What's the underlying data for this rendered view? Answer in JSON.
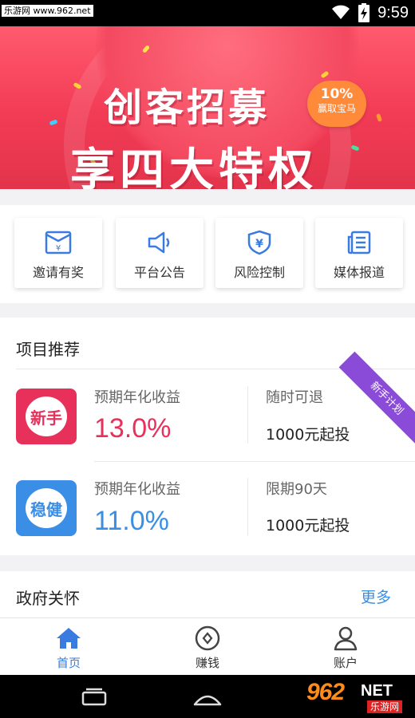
{
  "status_bar": {
    "watermark": "乐游网 www.962.net",
    "time": "9:59"
  },
  "banner": {
    "headline_1": "创客招募",
    "headline_2": "享四大特权",
    "badge_percent": "10%",
    "badge_text": "赢取宝马",
    "page_count": 3,
    "active_page": 2
  },
  "quick_entries": [
    {
      "label": "邀请有奖",
      "icon": "invite-envelope-icon"
    },
    {
      "label": "平台公告",
      "icon": "megaphone-icon"
    },
    {
      "label": "风险控制",
      "icon": "shield-yen-icon"
    },
    {
      "label": "媒体报道",
      "icon": "news-icon"
    }
  ],
  "recommend": {
    "title": "项目推荐",
    "ribbon": "新手计划",
    "products": [
      {
        "badge": "新手",
        "rate_label": "预期年化收益",
        "rate": "13.0%",
        "term": "随时可退",
        "min_invest": "1000元起投",
        "color": "#e8315a"
      },
      {
        "badge": "稳健",
        "rate_label": "预期年化收益",
        "rate": "11.0%",
        "term": "限期90天",
        "min_invest": "1000元起投",
        "color": "#3a8ee6"
      }
    ]
  },
  "gov": {
    "title": "政府关怀",
    "more": "更多"
  },
  "tabs": [
    {
      "label": "首页",
      "icon": "home-icon",
      "active": true
    },
    {
      "label": "赚钱",
      "icon": "coin-icon",
      "active": false
    },
    {
      "label": "账户",
      "icon": "user-icon",
      "active": false
    }
  ],
  "logo": {
    "number": "962",
    "net": "NET",
    "sub": "乐游网"
  },
  "colors": {
    "accent_blue": "#3a7be0",
    "banner_red": "#f23b55",
    "product_red": "#e8315a",
    "ribbon_purple": "#8a4bd8"
  }
}
